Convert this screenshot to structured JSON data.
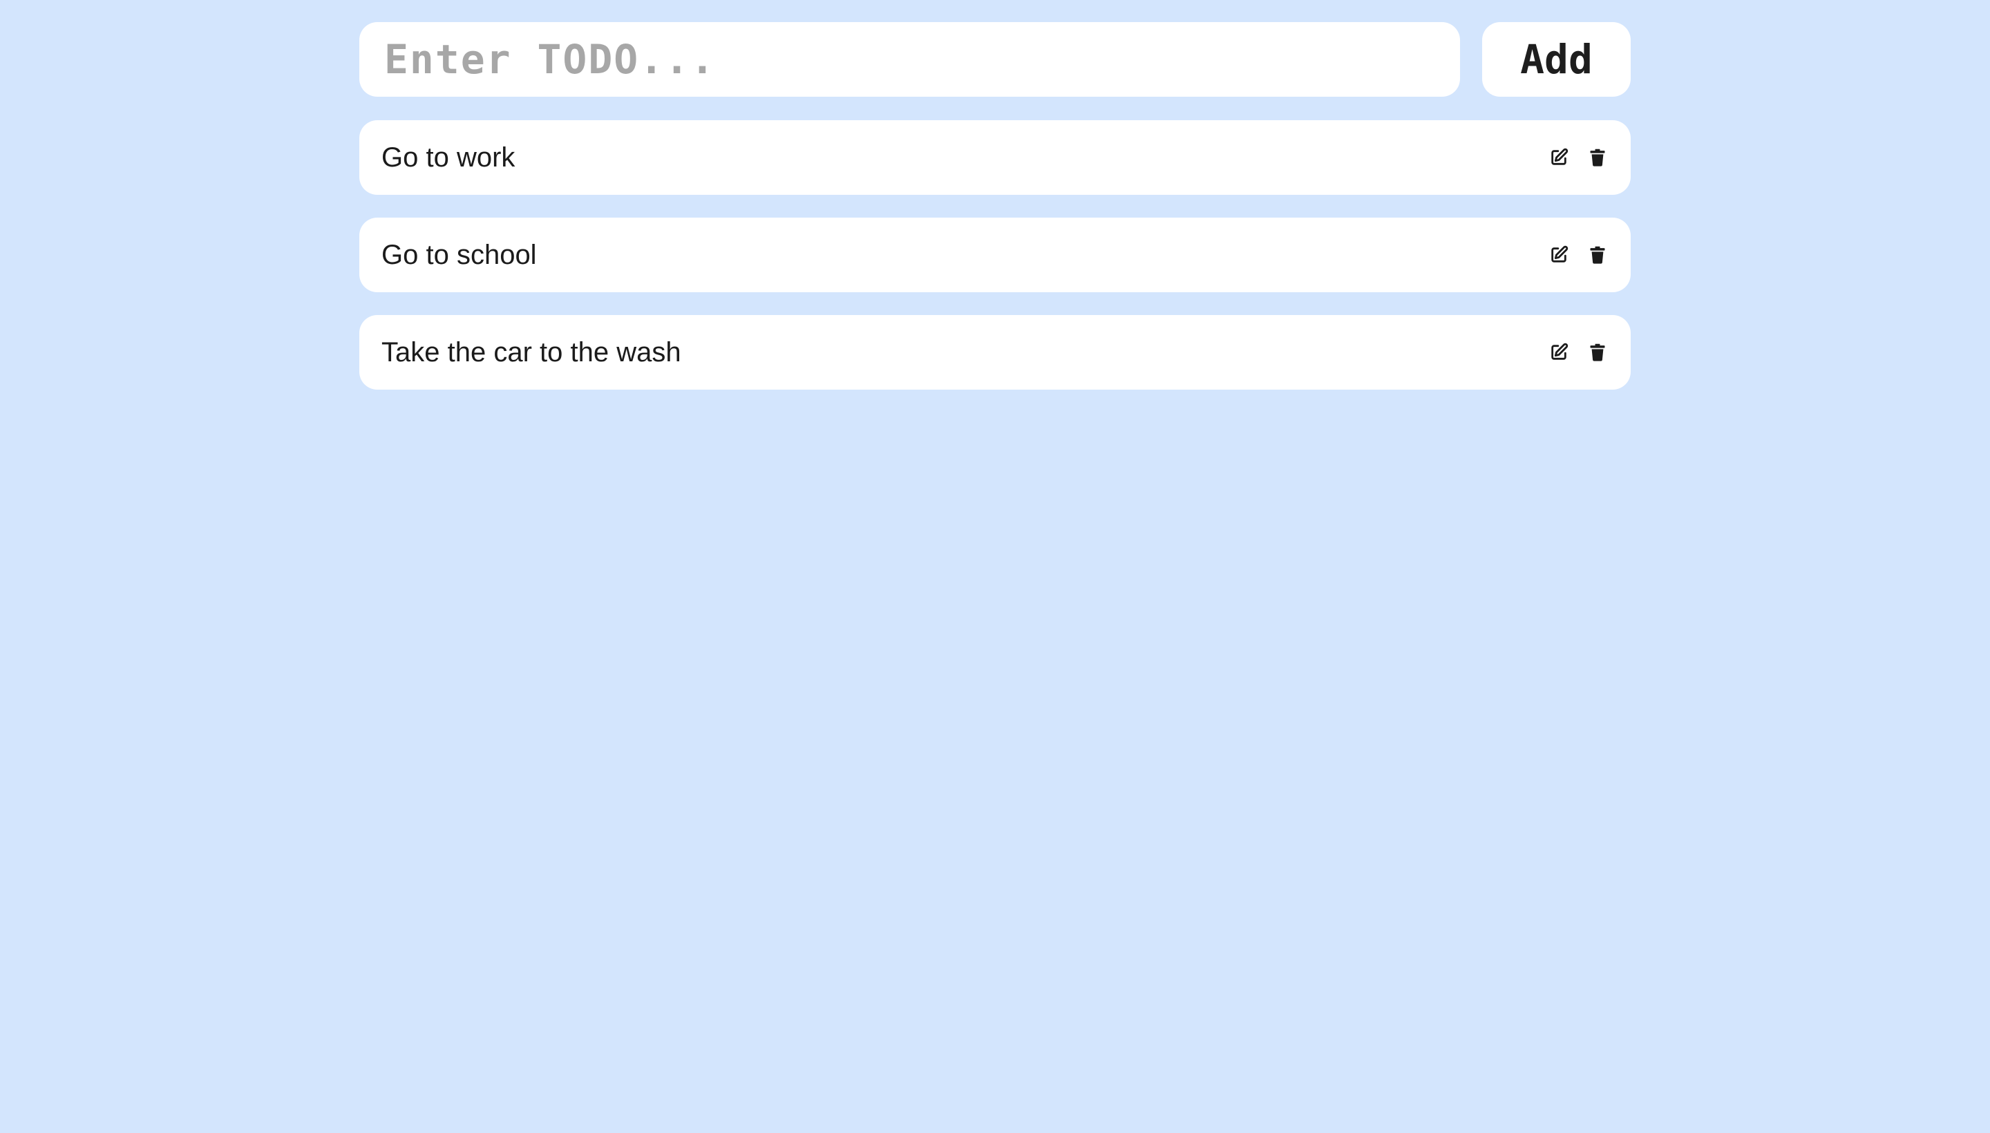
{
  "form": {
    "input_placeholder": "Enter TODO...",
    "input_value": "",
    "add_label": "Add"
  },
  "todos": [
    {
      "text": "Go to work",
      "actions": [
        "edit-icon",
        "trash-icon"
      ]
    },
    {
      "text": "Go to school",
      "actions": [
        "edit-icon",
        "trash-icon"
      ]
    },
    {
      "text": "Take the car to the wash",
      "actions": [
        "edit-icon",
        "trash-icon"
      ]
    }
  ],
  "colors": {
    "background": "#d3e5fd",
    "card": "#ffffff",
    "text": "#1b1b1b",
    "placeholder": "#a7a7a7"
  }
}
